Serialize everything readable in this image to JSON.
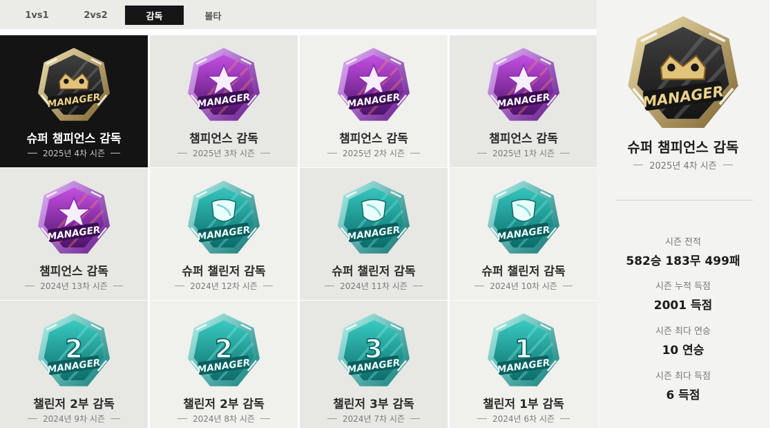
{
  "tabs": [
    {
      "label": "1vs1",
      "active": false
    },
    {
      "label": "2vs2",
      "active": false
    },
    {
      "label": "감독",
      "active": true
    },
    {
      "label": "볼타",
      "active": false
    }
  ],
  "badges": [
    {
      "title": "슈퍼 챔피언스 감독",
      "season": "2025년 4차 시즌",
      "type": "super-champions",
      "emblem": "crown-icon",
      "badge_text": "MANAGER",
      "selected": true
    },
    {
      "title": "챔피언스 감독",
      "season": "2025년 3차 시즌",
      "type": "champions",
      "emblem": "star-icon",
      "badge_text": "MANAGER",
      "selected": false
    },
    {
      "title": "챔피언스 감독",
      "season": "2025년 2차 시즌",
      "type": "champions",
      "emblem": "star-icon",
      "badge_text": "MANAGER",
      "selected": false
    },
    {
      "title": "챔피언스 감독",
      "season": "2025년 1차 시즌",
      "type": "champions",
      "emblem": "star-icon",
      "badge_text": "MANAGER",
      "selected": false
    },
    {
      "title": "챔피언스 감독",
      "season": "2024년 13차 시즌",
      "type": "champions",
      "emblem": "star-icon",
      "badge_text": "MANAGER",
      "selected": false
    },
    {
      "title": "슈퍼 챌린저 감독",
      "season": "2024년 12차 시즌",
      "type": "super-challenger",
      "emblem": "shield-icon",
      "badge_text": "MANAGER",
      "selected": false
    },
    {
      "title": "슈퍼 챌린저 감독",
      "season": "2024년 11차 시즌",
      "type": "super-challenger",
      "emblem": "shield-icon",
      "badge_text": "MANAGER",
      "selected": false
    },
    {
      "title": "슈퍼 챌린저 감독",
      "season": "2024년 10차 시즌",
      "type": "super-challenger",
      "emblem": "shield-icon",
      "badge_text": "MANAGER",
      "selected": false
    },
    {
      "title": "챌린저 2부 감독",
      "season": "2024년 9차 시즌",
      "type": "challenger",
      "emblem": "2",
      "badge_text": "MANAGER",
      "selected": false
    },
    {
      "title": "챌린저 2부 감독",
      "season": "2024년 8차 시즌",
      "type": "challenger",
      "emblem": "2",
      "badge_text": "MANAGER",
      "selected": false
    },
    {
      "title": "챌린저 3부 감독",
      "season": "2024년 7차 시즌",
      "type": "challenger",
      "emblem": "3",
      "badge_text": "MANAGER",
      "selected": false
    },
    {
      "title": "챌린저 1부 감독",
      "season": "2024년 6차 시즌",
      "type": "challenger",
      "emblem": "1",
      "badge_text": "MANAGER",
      "selected": false
    }
  ],
  "detail": {
    "title": "슈퍼 챔피언스 감독",
    "season": "2025년 4차 시즌",
    "badge_type": "super-champions",
    "badge_text": "MANAGER",
    "stats": [
      {
        "label": "시즌 전적",
        "value": "582승 183무 499패"
      },
      {
        "label": "시즌 누적 득점",
        "value": "2001 득점"
      },
      {
        "label": "시즌 최다 연승",
        "value": "10 연승"
      },
      {
        "label": "시즌 최다 득점",
        "value": "6 득점"
      }
    ]
  },
  "colors": {
    "selected_bg": "#141414",
    "tab_active_bg": "#161616",
    "panel_bg": "#f3f3f1",
    "gold": "#c9a54e",
    "purple": "#8e2bb5",
    "teal": "#1fb3ad"
  }
}
